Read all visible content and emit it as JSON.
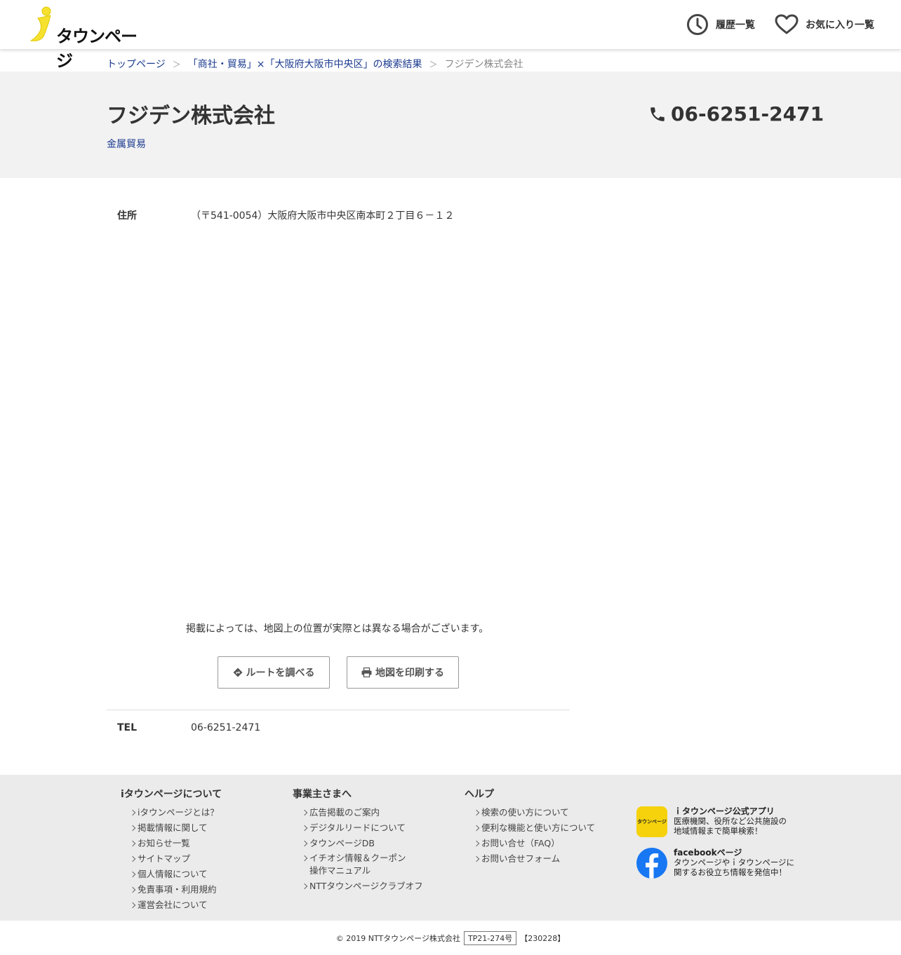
{
  "header": {
    "logo_text": "タウンページ",
    "history_label": "履歴一覧",
    "favorites_label": "お気に入り一覧"
  },
  "breadcrumb": {
    "home": "トップページ",
    "search_result": "「商社・貿易」×「大阪府大阪市中央区」の検索結果",
    "current": "フジデン株式会社",
    "separator": "＞"
  },
  "business": {
    "name": "フジデン株式会社",
    "category": "金属貿易",
    "phone": "06-6251-2471"
  },
  "details": {
    "address_label": "住所",
    "address_value": "（〒541-0054）大阪府大阪市中央区南本町２丁目６－１２",
    "map_note": "掲載によっては、地図上の位置が実際とは異なる場合がございます。",
    "route_button": "ルートを調べる",
    "print_button": "地図を印刷する",
    "tel_label": "TEL",
    "tel_value": "06-6251-2471"
  },
  "footer": {
    "col1": {
      "title": "iタウンページについて",
      "items": [
        "iタウンページとは？",
        "掲載情報に関して",
        "お知らせ一覧",
        "サイトマップ",
        "個人情報について",
        "免責事項・利用規約",
        "運営会社について"
      ]
    },
    "col2": {
      "title": "事業主さまへ",
      "items": [
        "広告掲載のご案内",
        "デジタルリードについて",
        "タウンページDB",
        "イチオシ情報＆クーポン",
        "操作マニュアル",
        "NTTタウンページクラブオフ"
      ]
    },
    "col3": {
      "title": "ヘルプ",
      "items": [
        "検索の使い方について",
        "便利な機能と使い方について",
        "お問い合せ（FAQ）",
        "お問い合せフォーム"
      ]
    },
    "app_promo": {
      "icon_text": "タウンページ",
      "title": "ｉタウンページ公式アプリ",
      "line1": "医療機関、役所など公共施設の",
      "line2": "地域情報まで簡単検索！"
    },
    "fb_promo": {
      "title": "facebookページ",
      "line1": "タウンページやｉタウンページに",
      "line2": "関するお役立ち情報を発信中！"
    }
  },
  "copyright": {
    "text": "© 2019 NTTタウンページ株式会社",
    "code": "TP21-274号",
    "date": "【230228】"
  },
  "colors": {
    "link": "#1a3a8f",
    "band": "#f2f2f2",
    "footer": "#ebebeb",
    "logo_yellow": "#f5e12e",
    "facebook": "#1877f2"
  }
}
